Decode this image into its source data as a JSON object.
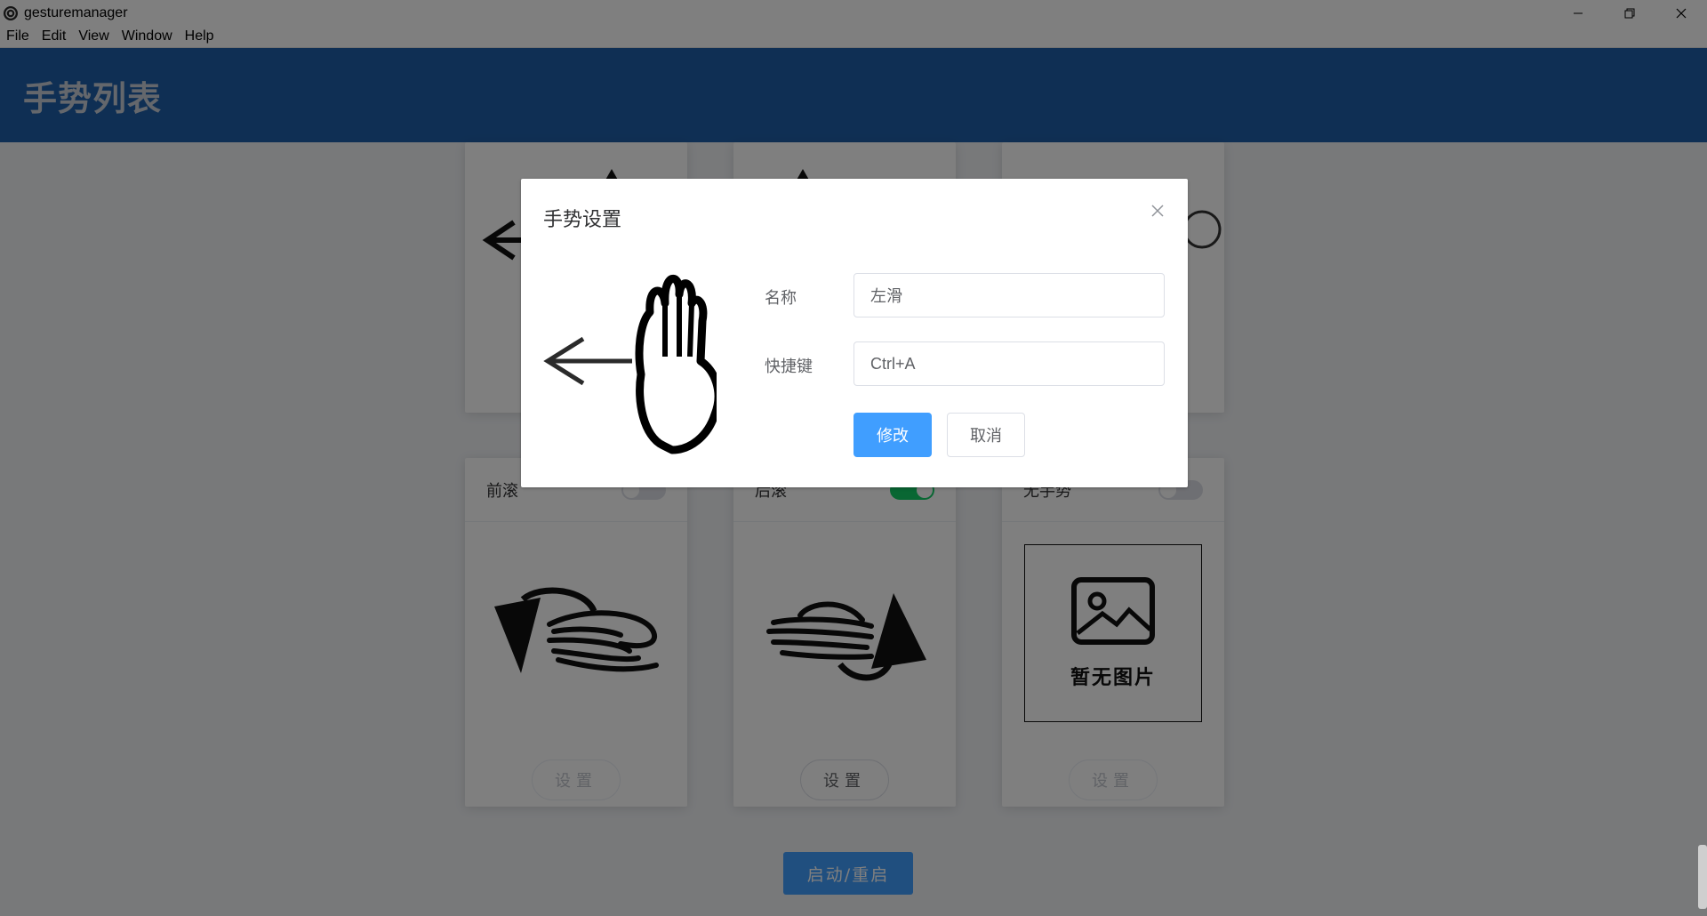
{
  "window": {
    "title": "gesturemanager"
  },
  "menubar": [
    "File",
    "Edit",
    "View",
    "Window",
    "Help"
  ],
  "header": {
    "title": "手势列表"
  },
  "cards": [
    {
      "name": "前滚",
      "enabled": false,
      "button": "设置",
      "icon": "roll-forward-hand-icon"
    },
    {
      "name": "后滚",
      "enabled": true,
      "button": "设置",
      "icon": "roll-backward-hand-icon"
    },
    {
      "name": "无手势",
      "enabled": false,
      "button": "设置",
      "icon": "image-placeholder-icon",
      "placeholder_text": "暂无图片"
    }
  ],
  "start_button": "启动/重启",
  "dialog": {
    "title": "手势设置",
    "name_label": "名称",
    "name_value": "左滑",
    "shortcut_label": "快捷键",
    "shortcut_value": "Ctrl+A",
    "confirm_label": "修改",
    "cancel_label": "取消",
    "image_icon": "swipe-left-hand-icon"
  },
  "colors": {
    "header": "#1f5fa8",
    "primary": "#409eff",
    "switch_on": "#13ce66"
  }
}
